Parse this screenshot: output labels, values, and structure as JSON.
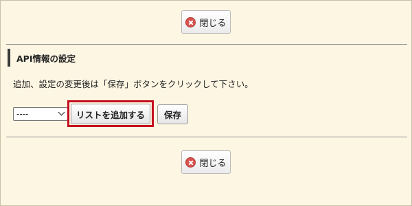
{
  "top_close": {
    "label": "閉じる",
    "icon": "close-icon"
  },
  "section": {
    "title": "API情報の設定"
  },
  "instruction": "追加、設定の変更後は「保存」ボタンをクリックして下さい。",
  "form": {
    "select_value": "----",
    "add_list_label": "リストを追加する",
    "save_label": "保存"
  },
  "bottom_close": {
    "label": "閉じる",
    "icon": "close-icon"
  },
  "colors": {
    "background": "#fdf6e3",
    "highlight": "#c40f1f",
    "close_icon": "#d9534f"
  }
}
